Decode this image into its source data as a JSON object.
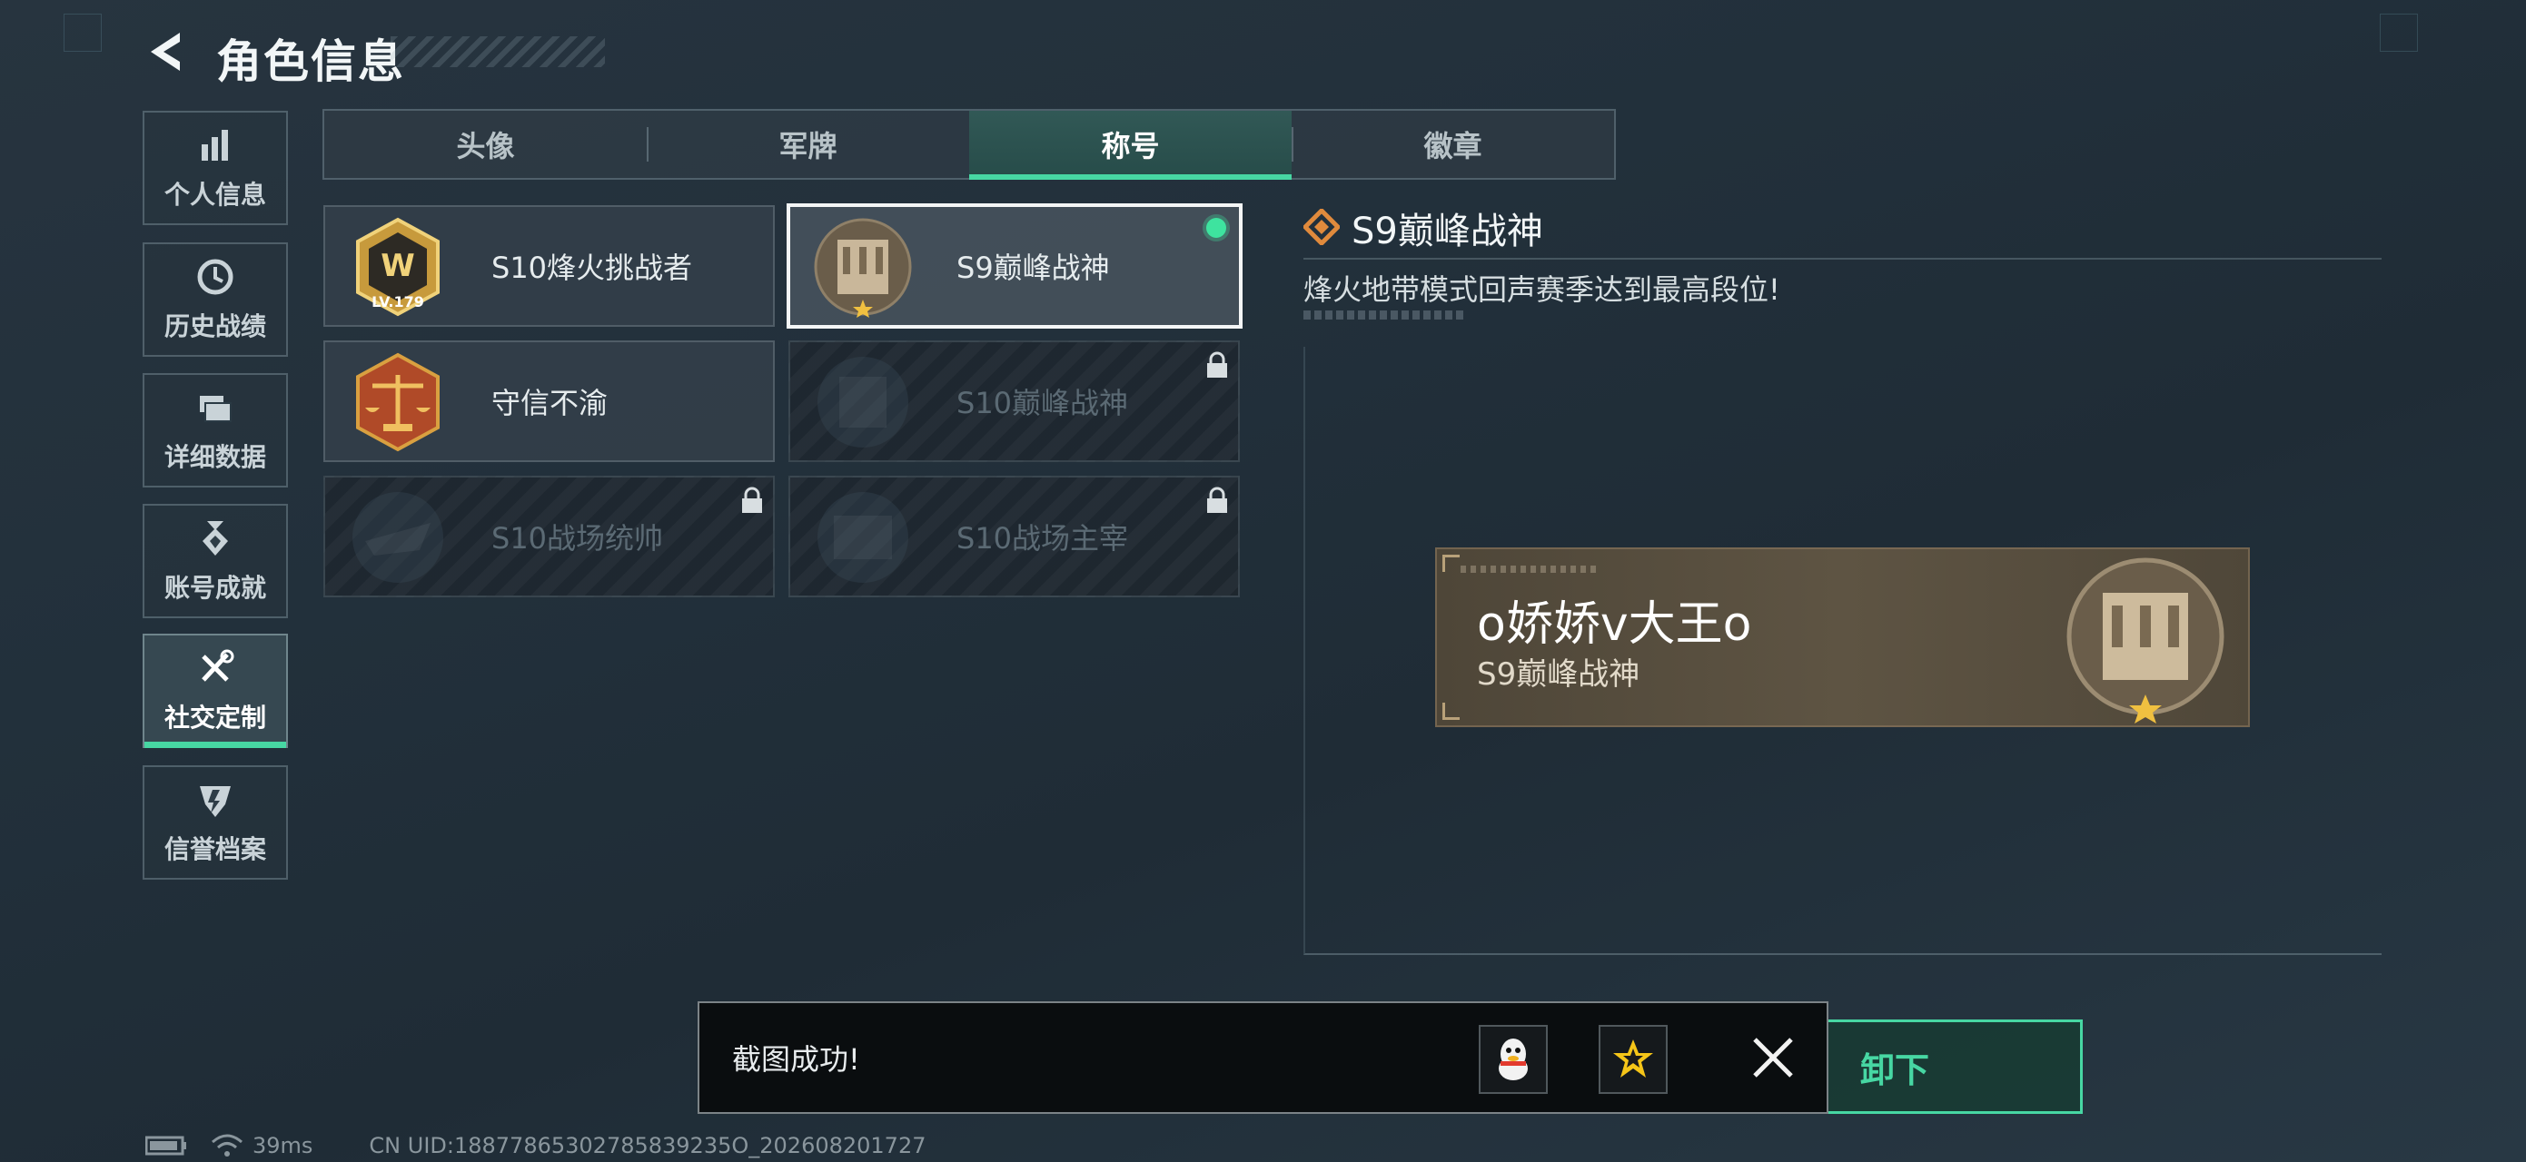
{
  "header": {
    "title": "角色信息"
  },
  "sidebar": {
    "items": [
      {
        "label": "个人信息",
        "icon": "bar-chart-icon"
      },
      {
        "label": "历史战绩",
        "icon": "clock-icon"
      },
      {
        "label": "详细数据",
        "icon": "folder-icon"
      },
      {
        "label": "账号成就",
        "icon": "medal-icon"
      },
      {
        "label": "社交定制",
        "icon": "tools-icon",
        "active": true
      },
      {
        "label": "信誉档案",
        "icon": "shield-icon"
      }
    ]
  },
  "tabs": [
    {
      "label": "头像"
    },
    {
      "label": "军牌"
    },
    {
      "label": "称号",
      "active": true
    },
    {
      "label": "徽章"
    }
  ],
  "titles": [
    {
      "name": "S10烽火挑战者",
      "emblem_text": "LV.179",
      "locked": false
    },
    {
      "name": "S9巅峰战神",
      "locked": false,
      "selected": true
    },
    {
      "name": "守信不渝",
      "locked": false
    },
    {
      "name": "S10巅峰战神",
      "locked": true
    },
    {
      "name": "S10战场统帅",
      "locked": true
    },
    {
      "name": "S10战场主宰",
      "locked": true
    }
  ],
  "detail": {
    "title": "S9巅峰战神",
    "description": "烽火地带模式回声赛季达到最高段位!"
  },
  "nameplate": {
    "player_name": "o娇娇v大王o",
    "title": "S9巅峰战神"
  },
  "unequip_button": {
    "label": "卸下"
  },
  "toast": {
    "message": "截图成功!",
    "share_icons": [
      "qq-icon",
      "star-share-icon"
    ],
    "close_icon": "close-icon"
  },
  "footer": {
    "ping": "39ms",
    "uid": "CN UID:18877865302785839235O_202608201727"
  },
  "colors": {
    "accent": "#47d7a3",
    "background": "#24323d",
    "nameplate": "#5a5040"
  }
}
